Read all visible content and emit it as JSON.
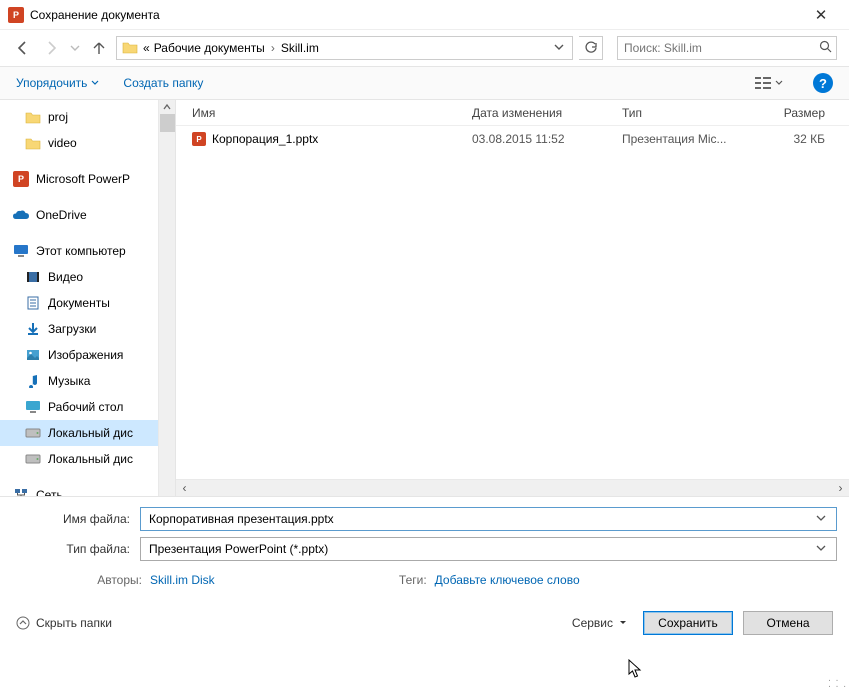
{
  "window": {
    "title": "Сохранение документа"
  },
  "address": {
    "prefix": "«",
    "crumbs": [
      "Рабочие документы",
      "Skill.im"
    ]
  },
  "search": {
    "placeholder": "Поиск: Skill.im"
  },
  "toolbar": {
    "organize": "Упорядочить",
    "newfolder": "Создать папку"
  },
  "sidebar": {
    "items": [
      {
        "label": "proj",
        "icon": "folder",
        "level": 1
      },
      {
        "label": "video",
        "icon": "folder",
        "level": 1
      },
      {
        "label": "Microsoft PowerP",
        "icon": "pp",
        "level": 0
      },
      {
        "label": "OneDrive",
        "icon": "onedrive",
        "level": 0
      },
      {
        "label": "Этот компьютер",
        "icon": "pc",
        "level": 0
      },
      {
        "label": "Видео",
        "icon": "video",
        "level": 1
      },
      {
        "label": "Документы",
        "icon": "docs",
        "level": 1
      },
      {
        "label": "Загрузки",
        "icon": "download",
        "level": 1
      },
      {
        "label": "Изображения",
        "icon": "images",
        "level": 1
      },
      {
        "label": "Музыка",
        "icon": "music",
        "level": 1
      },
      {
        "label": "Рабочий стол",
        "icon": "desktop",
        "level": 1
      },
      {
        "label": "Локальный дис",
        "icon": "disk",
        "level": 1,
        "selected": true
      },
      {
        "label": "Локальный дис",
        "icon": "disk",
        "level": 1
      },
      {
        "label": "Сеть",
        "icon": "network",
        "level": 0
      }
    ]
  },
  "columns": {
    "name": "Имя",
    "date": "Дата изменения",
    "type": "Тип",
    "size": "Размер"
  },
  "files": [
    {
      "name": "Корпорация_1.pptx",
      "date": "03.08.2015 11:52",
      "type": "Презентация Mic...",
      "size": "32 КБ"
    }
  ],
  "form": {
    "name_label": "Имя файла:",
    "name_value": "Корпоративная презентация.pptx",
    "type_label": "Тип файла:",
    "type_value": "Презентация PowerPoint (*.pptx)"
  },
  "meta": {
    "authors_label": "Авторы:",
    "authors_value": "Skill.im Disk",
    "tags_label": "Теги:",
    "tags_value": "Добавьте ключевое слово"
  },
  "actions": {
    "hide": "Скрыть папки",
    "service": "Сервис",
    "save": "Сохранить",
    "cancel": "Отмена"
  }
}
